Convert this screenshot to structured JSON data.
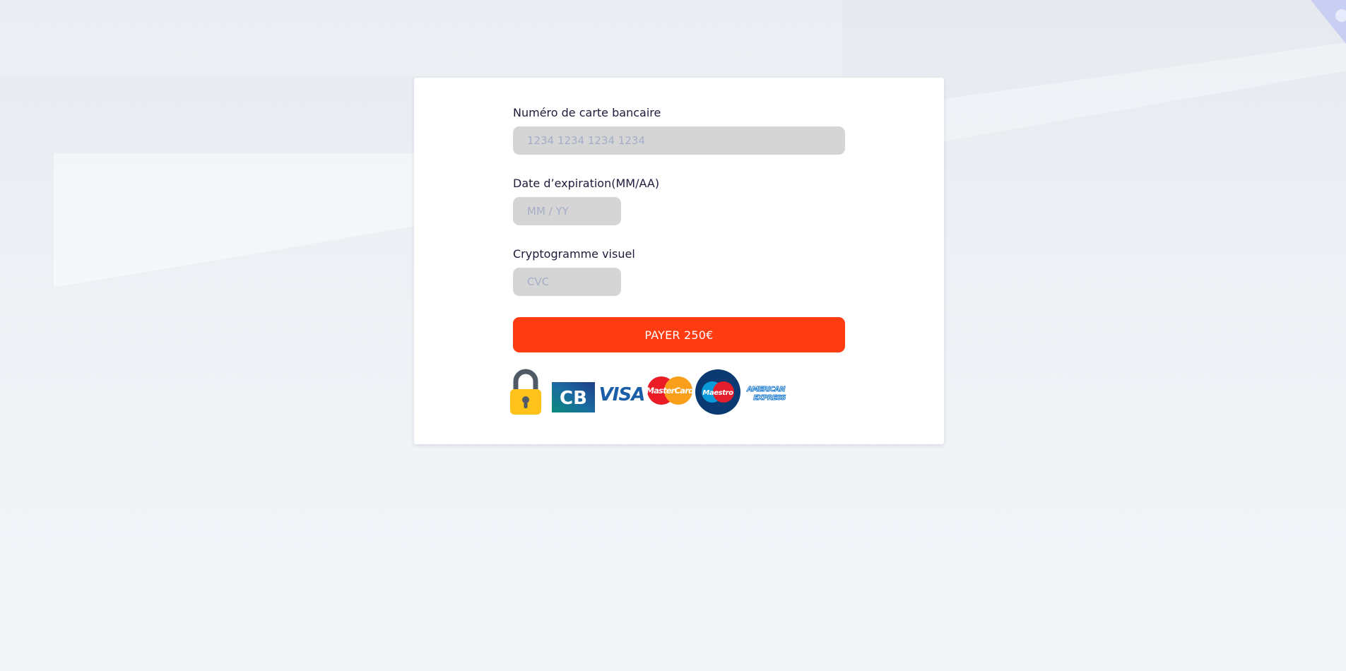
{
  "form": {
    "card_number": {
      "label": "Numéro de carte bancaire",
      "placeholder": "1234 1234 1234 1234",
      "value": ""
    },
    "expiry": {
      "label": "Date d’expiration(MM/AA)",
      "placeholder": "MM / YY",
      "value": ""
    },
    "cvc": {
      "label": "Cryptogramme visuel",
      "placeholder": "CVC",
      "value": ""
    },
    "pay_button_label": "PAYER 250€"
  },
  "payment_logos": {
    "icons": [
      "lock-icon",
      "cb-logo",
      "visa-logo",
      "mastercard-logo",
      "maestro-logo",
      "american-express-logo"
    ],
    "cb_text": "CB",
    "visa_text": "VISA",
    "mastercard_text": "MasterCard",
    "maestro_text": "Maestro",
    "amex_line1": "AMERICAN",
    "amex_line2": "EXPRESS"
  },
  "colors": {
    "primary_button": "#ff3b12",
    "field_background": "#d6d5d5",
    "placeholder": "#a4adc8",
    "label_text": "#1c1b3a",
    "lock_body": "#ffc21a",
    "lock_shackle": "#4e5a66"
  }
}
